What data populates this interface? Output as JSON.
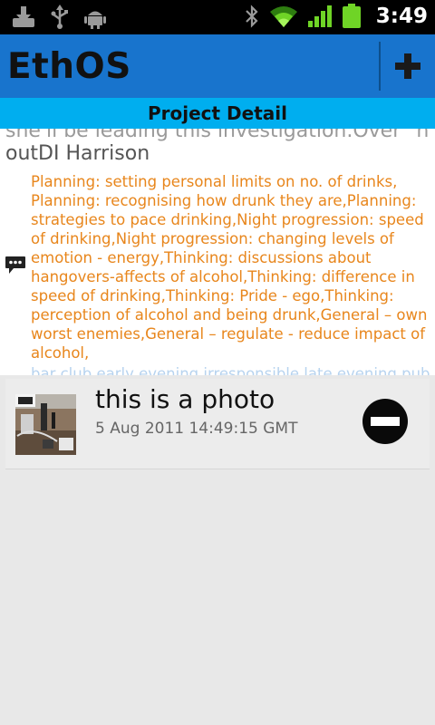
{
  "status_bar": {
    "time": "3:49",
    "icons": [
      "download-icon",
      "usb-icon",
      "android-icon",
      "bluetooth-icon",
      "wifi-icon",
      "signal-icon",
      "battery-icon"
    ]
  },
  "action_bar": {
    "title": "EthOS",
    "add_icon": "plus-icon",
    "color": "#1874cd"
  },
  "sub_header": {
    "title": "Project Detail",
    "color": "#00aeef"
  },
  "content": {
    "cut_line": "she'll be leading this investigation.Over \"h",
    "investigator": "outDI Harrison",
    "codes": "Planning: setting personal limits on no. of drinks, Planning: recognising how drunk they are,Planning: strategies to pace drinking,Night progression: speed of drinking,Night progression: changing levels of emotion - energy,Thinking: discussions about hangovers-affects of alcohol,Thinking: difference in speed of drinking,Thinking: Pride - ego,Thinking: perception of alcohol and being drunk,General – own worst enemies,General – regulate - reduce impact of alcohol,",
    "faded": "bar,club,early evening,irresponsible,late evening,pub",
    "code_color": "#e8861c"
  },
  "media_item": {
    "title": "this is a photo",
    "date": "5 Aug 2011 14:49:15 GMT",
    "remove_icon": "remove-circle-icon"
  }
}
